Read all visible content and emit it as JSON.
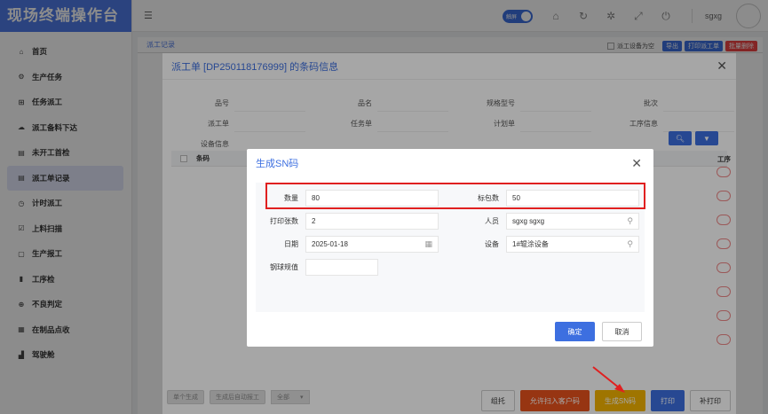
{
  "brand": "现场终端操作台",
  "sidebar": {
    "items": [
      {
        "icon": "home-icon",
        "glyph": "⌂",
        "label": "首页"
      },
      {
        "icon": "gears-icon",
        "glyph": "⚙",
        "label": "生产任务"
      },
      {
        "icon": "sitemap-icon",
        "glyph": "⊞",
        "label": "任务派工"
      },
      {
        "icon": "cloud-download-icon",
        "glyph": "☁",
        "label": "派工备料下达"
      },
      {
        "icon": "id-card-icon",
        "glyph": "▤",
        "label": "未开工首检"
      },
      {
        "icon": "id-card-icon",
        "glyph": "▤",
        "label": "派工单记录",
        "active": true
      },
      {
        "icon": "clock-icon",
        "glyph": "◷",
        "label": "计时派工"
      },
      {
        "icon": "check-square-icon",
        "glyph": "☑",
        "label": "上料扫描"
      },
      {
        "icon": "note-icon",
        "glyph": "▢",
        "label": "生产报工"
      },
      {
        "icon": "file-icon",
        "glyph": "▮",
        "label": "工序检"
      },
      {
        "icon": "search-plus-icon",
        "glyph": "⊕",
        "label": "不良判定"
      },
      {
        "icon": "archive-icon",
        "glyph": "▦",
        "label": "在制品点收"
      },
      {
        "icon": "area-chart-icon",
        "glyph": "▟",
        "label": "驾驶舱"
      }
    ]
  },
  "topbar": {
    "toggle_label": "触屏",
    "username": "sgxg"
  },
  "page": {
    "tab": "派工记录",
    "check_label": "派工设备为空",
    "btn_export": "导出",
    "btn_print": "打印派工单",
    "btn_delete": "批量删除",
    "bottom_left": [
      "单个生成",
      "生成后自动报工"
    ],
    "bottom_select": "全部",
    "actions": [
      {
        "label": "组托",
        "style": ""
      },
      {
        "label": "允许扫入客户码",
        "style": "orange"
      },
      {
        "label": "生成SN码",
        "style": "yellow"
      },
      {
        "label": "打印",
        "style": "blue"
      },
      {
        "label": "补打印",
        "style": ""
      }
    ]
  },
  "dialog1": {
    "title": "派工单 [DP250118176999] 的条码信息",
    "labels": [
      [
        "品号",
        "品名",
        "规格型号",
        "批次"
      ],
      [
        "派工单",
        "任务单",
        "计划单",
        "工序信息"
      ],
      [
        "设备信息"
      ]
    ],
    "table_col": "条码",
    "table_tail": "工序"
  },
  "dialog2": {
    "title": "生成SN码",
    "fields": {
      "qty_label": "数量",
      "qty_value": "80",
      "pack_label": "标包数",
      "pack_value": "50",
      "copies_label": "打印张数",
      "copies_value": "2",
      "person_label": "人员",
      "person_value": "sgxg sgxg",
      "date_label": "日期",
      "date_value": "2025-01-18",
      "device_label": "设备",
      "device_value": "1#辊涂设备",
      "ball_label": "钢球规值",
      "ball_value": ""
    },
    "ok": "确定",
    "cancel": "取消"
  },
  "colors": {
    "primary": "#3d6fe0",
    "brand": "#4f7be8",
    "highlight": "#e02020",
    "orange": "#e8521c",
    "yellow": "#f4b400"
  }
}
